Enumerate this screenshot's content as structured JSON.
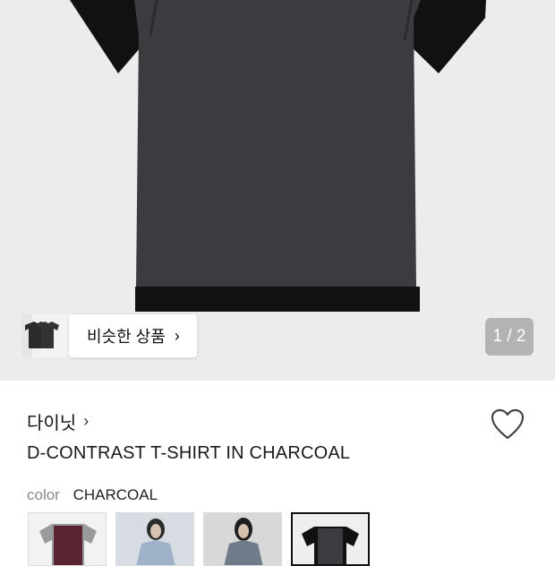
{
  "gallery": {
    "similar_label": "비슷한 상품",
    "similar_chevron": "›",
    "counter": "1 / 2"
  },
  "product": {
    "brand": "다이닛",
    "brand_chevron": "›",
    "name": "D-CONTRAST T-SHIRT IN CHARCOAL",
    "color_label": "color",
    "color_value": "CHARCOAL"
  },
  "colors": {
    "background": "#ececec",
    "shirt_body": "#3d3d41",
    "shirt_black": "#111111",
    "counter_bg": "#b3b3b3"
  },
  "swatches": [
    {
      "name": "burgundy-grey-variant",
      "selected": false
    },
    {
      "name": "model-photo-1",
      "selected": false
    },
    {
      "name": "model-photo-2",
      "selected": false
    },
    {
      "name": "charcoal-black-variant",
      "selected": true
    }
  ]
}
